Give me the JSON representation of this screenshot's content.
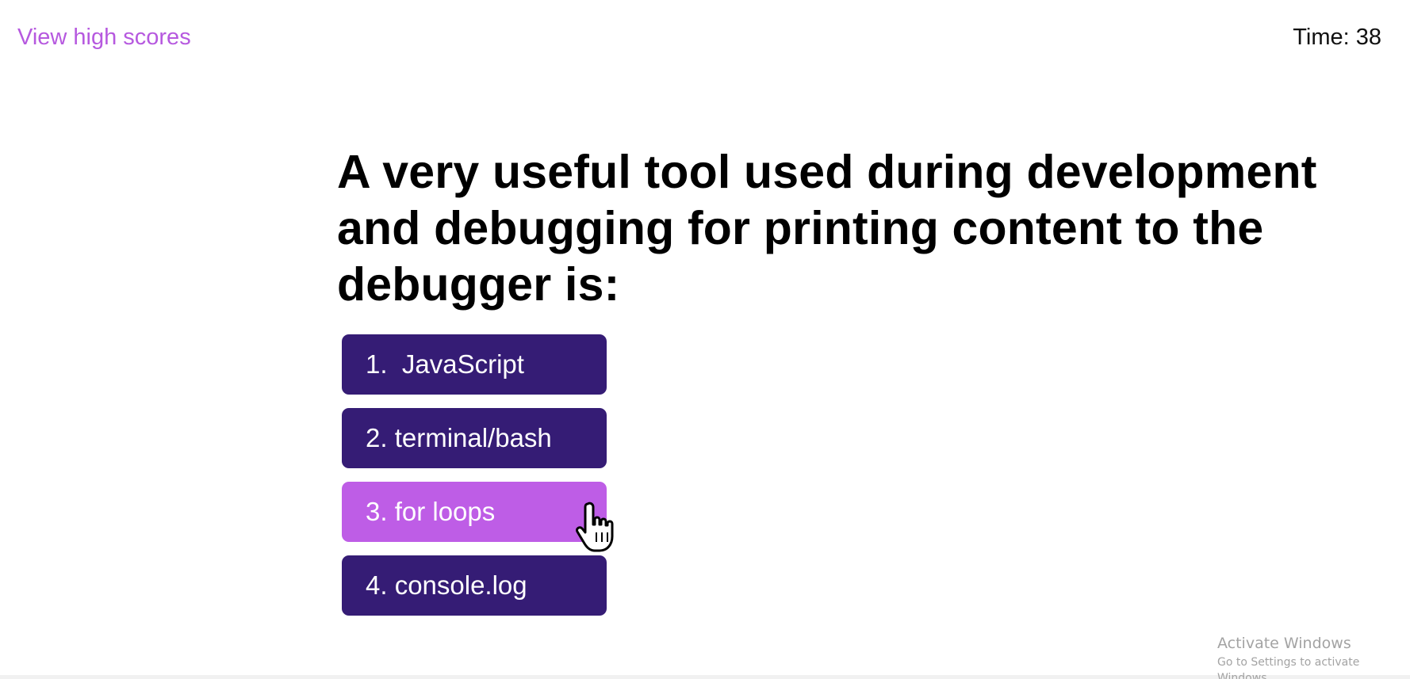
{
  "header": {
    "high_scores_link": "View high scores",
    "timer_label": "Time:",
    "timer_value": "38"
  },
  "quiz": {
    "question": "A very useful tool used during development and debugging for printing content to the debugger is:",
    "answers": [
      {
        "label": "1.  JavaScript"
      },
      {
        "label": "2. terminal/bash"
      },
      {
        "label": "3. for loops"
      },
      {
        "label": "4. console.log"
      }
    ],
    "hovered_answer_index": 2
  },
  "cursor": {
    "icon": "hand-pointer-icon"
  },
  "watermark": {
    "title": "Activate Windows",
    "subtitle": "Go to Settings to activate Windows."
  },
  "colors": {
    "accent_link": "#b659df",
    "answer_button": "#351c75",
    "answer_button_hover": "#be5de6"
  }
}
